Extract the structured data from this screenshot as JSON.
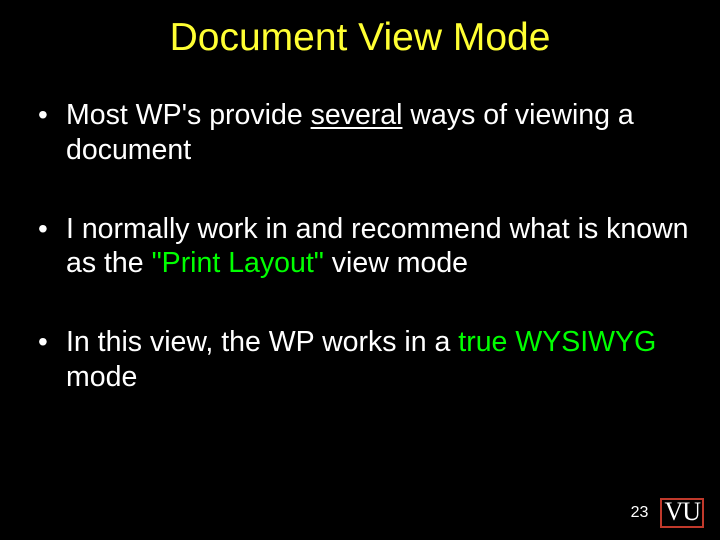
{
  "title": "Document View Mode",
  "bullets": {
    "b1": {
      "p1": "Most WP's provide ",
      "underlined": "several",
      "p2": " ways of viewing a document"
    },
    "b2": {
      "p1": "I normally work in and recommend what is known as the ",
      "green": "\"Print Layout\"",
      "p2": " view mode"
    },
    "b3": {
      "p1": "In this view, the WP works in a ",
      "green": "true WYSIWYG",
      "p2": " mode"
    }
  },
  "page_number": "23",
  "logo_text": "VU"
}
